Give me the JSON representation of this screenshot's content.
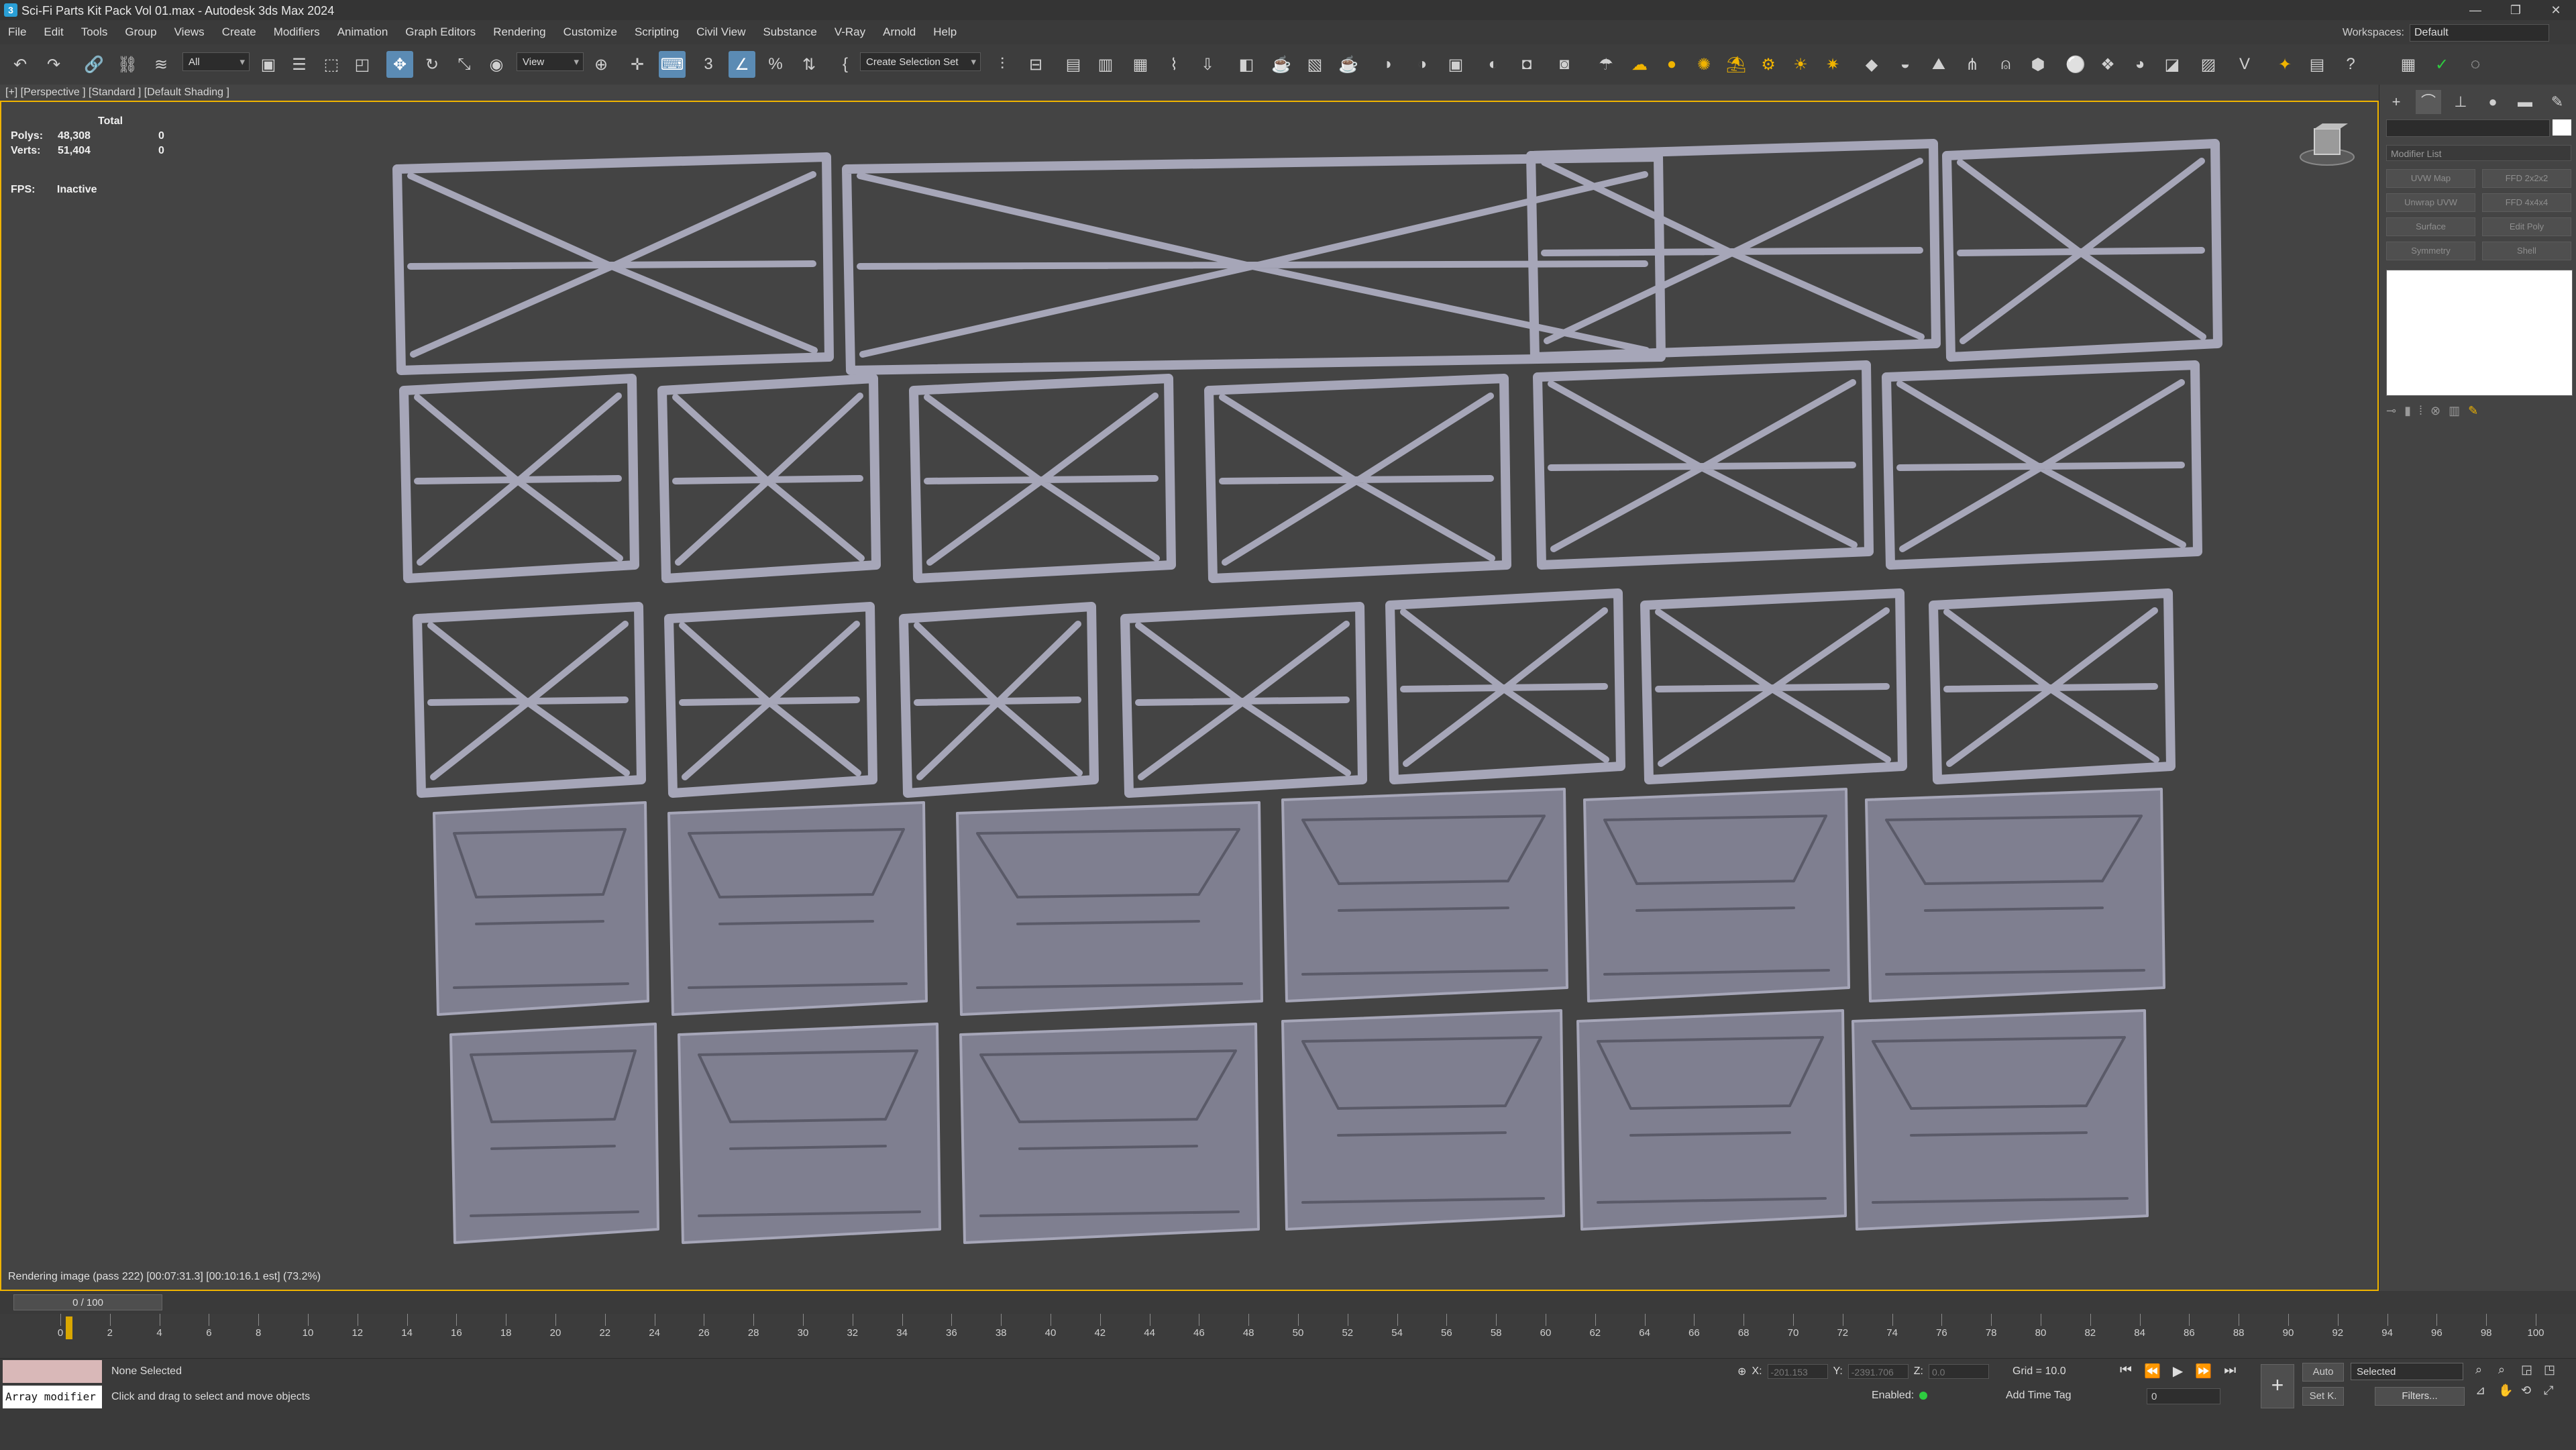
{
  "window": {
    "title": "Sci-Fi Parts Kit Pack Vol 01.max - Autodesk 3ds Max 2024",
    "app_icon": "3ds-max-icon",
    "controls": [
      "—",
      "❐",
      "✕"
    ]
  },
  "menu": {
    "items": [
      "File",
      "Edit",
      "Tools",
      "Group",
      "Views",
      "Create",
      "Modifiers",
      "Animation",
      "Graph Editors",
      "Rendering",
      "Customize",
      "Scripting",
      "Civil View",
      "Substance",
      "V-Ray",
      "Arnold",
      "Help"
    ],
    "workspace_label": "Workspaces:",
    "workspace_value": "Default"
  },
  "toolbar": {
    "filter_value": "All",
    "ref_coord_value": "View",
    "selection_set_value": "Create Selection Set"
  },
  "viewport": {
    "label": "[+] [Perspective ] [Standard ] [Default Shading ]",
    "stats_header": "Total",
    "stats": [
      {
        "key": "Polys:",
        "total": "48,308",
        "sel": "0"
      },
      {
        "key": "Verts:",
        "total": "51,404",
        "sel": "0"
      }
    ],
    "fps_label": "FPS:",
    "fps_value": "Inactive",
    "render_status": "Rendering image (pass 222) [00:07:31.3] [00:10:16.1 est]     (73.2%)"
  },
  "command_panel": {
    "modifier_list": "Modifier List",
    "modifier_buttons": [
      "UVW Map",
      "FFD 2x2x2",
      "Unwrap UVW",
      "FFD 4x4x4",
      "Surface",
      "Edit Poly",
      "Symmetry",
      "Shell"
    ]
  },
  "timeline": {
    "slider_label": "0 / 100",
    "ticks": [
      0,
      2,
      4,
      6,
      8,
      10,
      12,
      14,
      16,
      18,
      20,
      22,
      24,
      26,
      28,
      30,
      32,
      34,
      36,
      38,
      40,
      42,
      44,
      46,
      48,
      50,
      52,
      54,
      56,
      58,
      60,
      62,
      64,
      66,
      68,
      70,
      72,
      74,
      76,
      78,
      80,
      82,
      84,
      86,
      88,
      90,
      92,
      94,
      96,
      98,
      100
    ]
  },
  "status": {
    "maxscript_text": "Array modifier",
    "selection": "None Selected",
    "prompt": "Click and drag to select and move objects",
    "x_label": "X:",
    "x_value": "-201.153",
    "y_label": "Y:",
    "y_value": "-2391.706",
    "z_label": "Z:",
    "z_value": "0.0",
    "grid": "Grid = 10.0",
    "enabled_label": "Enabled:",
    "add_time_tag": "Add Time Tag",
    "frame_value": "0",
    "auto_key": "Auto",
    "set_key": "Set K.",
    "selection_set": "Selected",
    "filters": "Filters..."
  }
}
